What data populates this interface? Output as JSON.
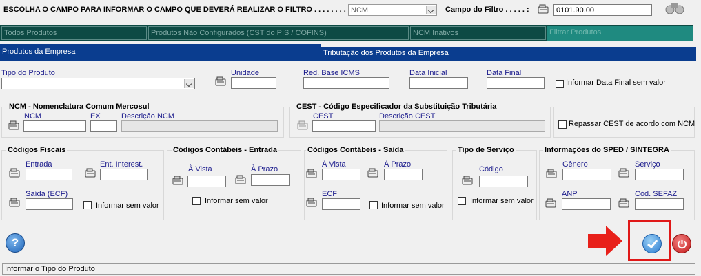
{
  "filter": {
    "question_label": "ESCOLHA O CAMPO PARA INFORMAR O CAMPO QUE DEVERÁ REALIZAR O FILTRO . . . . . . . . . :",
    "field_value": "NCM",
    "campo_label": "Campo do Filtro . . . . . :",
    "campo_value": "0101.90.00"
  },
  "tabs_top": [
    "Todos Produtos",
    "Produtos Não Configurados (CST do PIS / COFINS)",
    "NCM Inativos",
    "Filtrar Produtos"
  ],
  "tabs_second": [
    "Produtos da Empresa",
    "Tributação dos Produtos da Empresa"
  ],
  "row1": {
    "tipo_produto": "Tipo do Produto",
    "unidade": "Unidade",
    "red_base": "Red. Base ICMS",
    "data_inicial": "Data Inicial",
    "data_final": "Data Final",
    "informar_data_final": "Informar Data Final sem valor"
  },
  "ncm": {
    "title": "NCM - Nomenclatura Comum Mercosul",
    "ncm_label": "NCM",
    "ex_label": "EX",
    "desc_label": "Descrição NCM"
  },
  "cest": {
    "title": "CEST - Código Especificador da Substituição Tributária",
    "cest_label": "CEST",
    "desc_label": "Descrição CEST",
    "repassar": "Repassar CEST de acordo com NCM"
  },
  "fiscais": {
    "title": "Códigos Fiscais",
    "entrada": "Entrada",
    "ent_interest": "Ent. Interest.",
    "saida": "Saída (ECF)",
    "informar": "Informar sem valor"
  },
  "contabeis_entrada": {
    "title": "Códigos Contábeis - Entrada",
    "a_vista": "À Vista",
    "a_prazo": "À Prazo",
    "informar": "Informar sem valor"
  },
  "contabeis_saida": {
    "title": "Códigos Contábeis - Saída",
    "a_vista": "À Vista",
    "a_prazo": "À Prazo",
    "ecf": "ECF",
    "informar": "Informar sem valor"
  },
  "servico": {
    "title": "Tipo de Serviço",
    "codigo": "Código",
    "informar": "Informar sem valor"
  },
  "sped": {
    "title": "Informações do SPED / SINTEGRA",
    "genero": "Gênero",
    "servico": "Serviço",
    "anp": "ANP",
    "cod_sefaz": "Cód. SEFAZ"
  },
  "status_text": "Informar o Tipo do Produto",
  "colors": {
    "tab_dark": "#0d4a44",
    "tab_selected": "#1f8a80",
    "blue_bar": "#0a3d8f",
    "label_blue": "#1a1a8c",
    "arrow_red": "#e8201a",
    "highlight_red": "#e01818"
  }
}
